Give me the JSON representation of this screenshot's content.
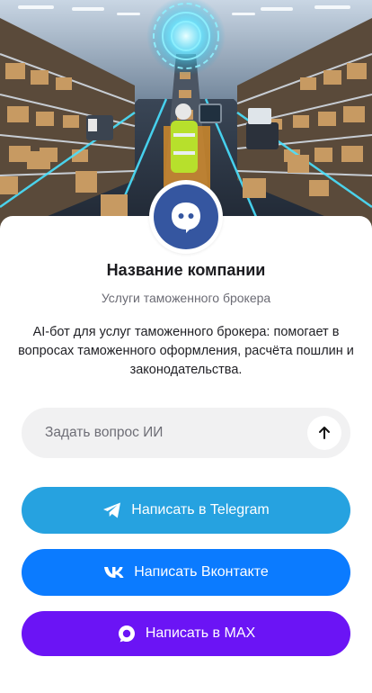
{
  "colors": {
    "telegram": "#26a2e0",
    "vk": "#0b7bff",
    "max": "#6b14f5",
    "avatar_bg": "#3556a0",
    "input_bg": "#f1f1f2"
  },
  "hero": {
    "image": "warehouse-illustration"
  },
  "avatar": {
    "icon": "chat-bot-icon"
  },
  "company": {
    "name": "Название компании",
    "subtitle": "Услуги таможенного брокера",
    "description": "AI-бот для услуг таможенного брокера: помогает в вопросах таможенного оформления, расчёта пошлин и законодательства."
  },
  "ask": {
    "placeholder": "Задать вопрос ИИ",
    "value": "",
    "send_icon": "arrow-up-icon"
  },
  "buttons": {
    "telegram": {
      "label": "Написать в Telegram",
      "icon": "telegram-icon"
    },
    "vk": {
      "label": "Написать Вконтакте",
      "icon": "vk-icon"
    },
    "max": {
      "label": "Написать в MAX",
      "icon": "max-icon"
    }
  }
}
